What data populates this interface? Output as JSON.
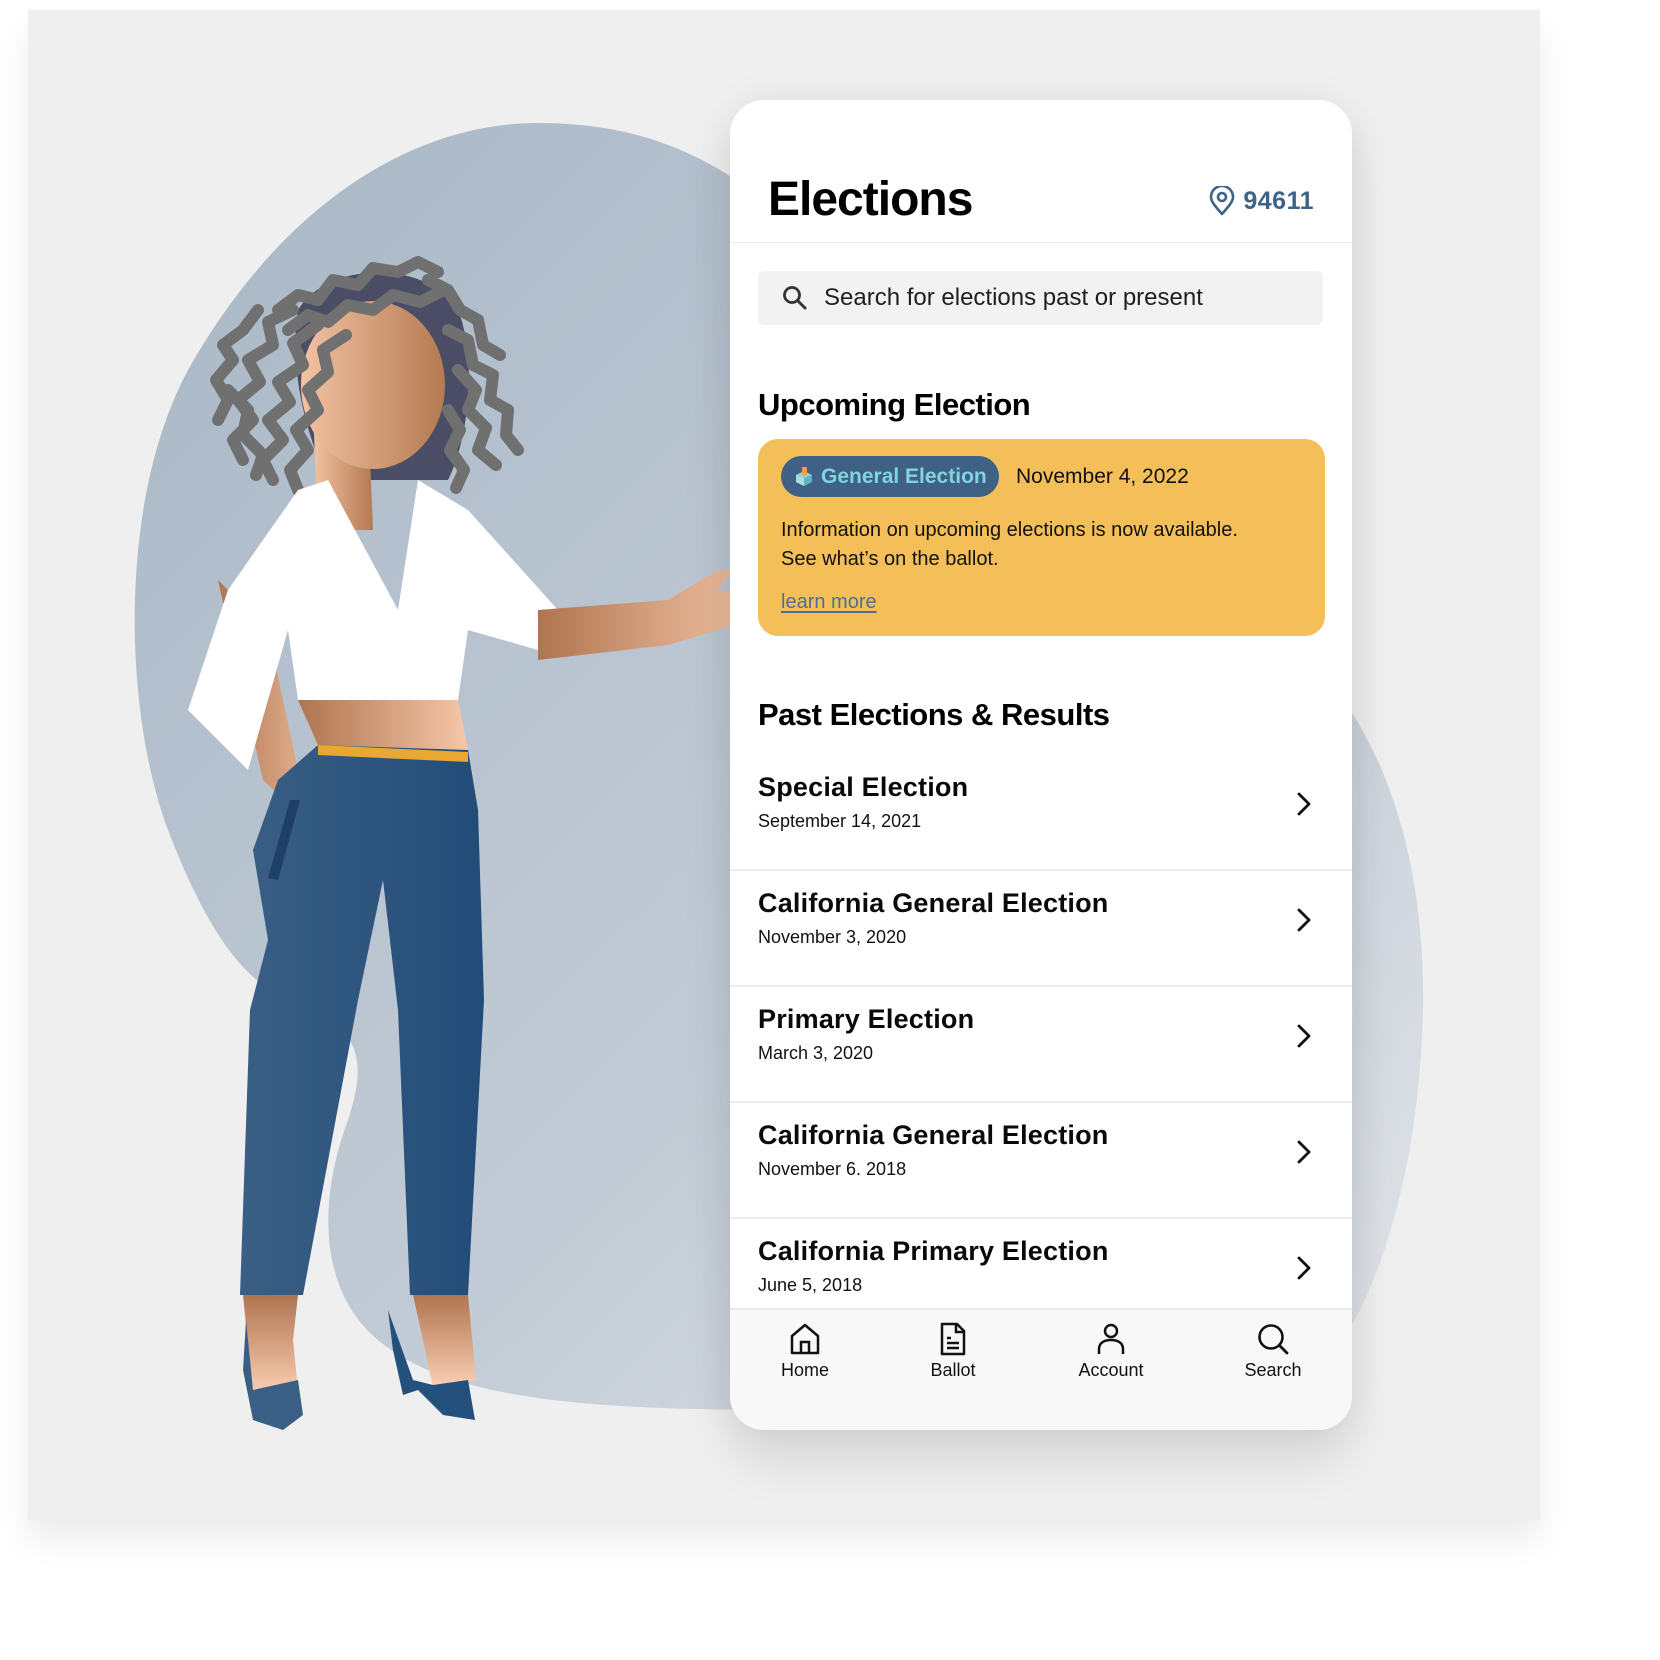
{
  "header": {
    "title": "Elections",
    "location_icon": "map-pin-icon",
    "zip_code": "94611"
  },
  "search": {
    "icon": "search-icon",
    "placeholder": "Search for elections past or present",
    "value": ""
  },
  "upcoming": {
    "section_title": "Upcoming Election",
    "badge_icon": "ballot-box-icon",
    "badge_label": "General Election",
    "date": "November 4, 2022",
    "text_line1": "Information on upcoming elections is now available.",
    "text_line2": "See what’s on the ballot.",
    "link_label": "learn more"
  },
  "past": {
    "section_title": "Past Elections & Results",
    "items": [
      {
        "name": "Special Election",
        "date": "September 14, 2021"
      },
      {
        "name": "California General Election",
        "date": "November 3, 2020"
      },
      {
        "name": "Primary Election",
        "date": "March 3, 2020"
      },
      {
        "name": "California General Election",
        "date": "November 6. 2018"
      },
      {
        "name": "California Primary Election",
        "date": "June 5, 2018"
      }
    ]
  },
  "bottom_nav": {
    "items": [
      {
        "label": "Home",
        "icon": "home-icon"
      },
      {
        "label": "Ballot",
        "icon": "document-icon"
      },
      {
        "label": "Account",
        "icon": "user-icon"
      },
      {
        "label": "Search",
        "icon": "search-icon"
      }
    ]
  },
  "colors": {
    "accent_blue": "#3f6288",
    "card_yellow": "#f4bf58",
    "badge_bg": "#406186",
    "badge_text": "#7fd4dd",
    "link": "#4e6f93"
  }
}
